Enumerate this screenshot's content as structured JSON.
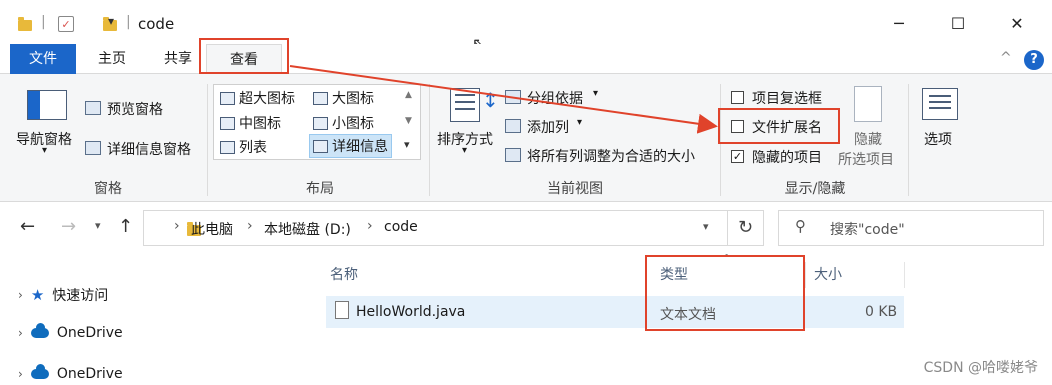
{
  "window": {
    "title": "code",
    "minimize": "─",
    "maximize": "☐",
    "close": "✕"
  },
  "tabs": {
    "file": "文件",
    "home": "主页",
    "share": "共享",
    "view": "查看"
  },
  "ribbon": {
    "panes": {
      "nav_pane": "导航窗格",
      "preview_pane": "预览窗格",
      "details_pane": "详细信息窗格",
      "group_label": "窗格"
    },
    "layout": {
      "items": [
        "超大图标",
        "大图标",
        "中图标",
        "小图标",
        "列表",
        "详细信息"
      ],
      "group_label": "布局"
    },
    "current_view": {
      "sort": "排序方式",
      "group_by": "分组依据",
      "add_column": "添加列",
      "fit_columns": "将所有列调整为合适的大小",
      "group_label": "当前视图"
    },
    "show_hide": {
      "item_checkboxes": "项目复选框",
      "file_extensions": "文件扩展名",
      "hidden_items": "隐藏的项目",
      "hide_selected_1": "隐藏",
      "hide_selected_2": "所选项目",
      "options": "选项",
      "group_label": "显示/隐藏",
      "item_checkboxes_checked": false,
      "file_extensions_checked": false,
      "hidden_items_checked": true
    }
  },
  "address": {
    "crumbs": [
      "此电脑",
      "本地磁盘 (D:)",
      "code"
    ],
    "search_placeholder": "搜索\"code\""
  },
  "nav": {
    "items": [
      "快速访问",
      "OneDrive",
      "OneDrive"
    ]
  },
  "columns": {
    "name": "名称",
    "type": "类型",
    "size": "大小"
  },
  "files": [
    {
      "name": "HelloWorld.java",
      "type": "文本文档",
      "size": "0 KB"
    }
  ],
  "watermark": "CSDN @哈喽姥爷",
  "colors": {
    "file_tab": "#1b66c9",
    "annotation": "#e0432b",
    "selection": "#e5f1fb",
    "help": "#1b66c9"
  }
}
